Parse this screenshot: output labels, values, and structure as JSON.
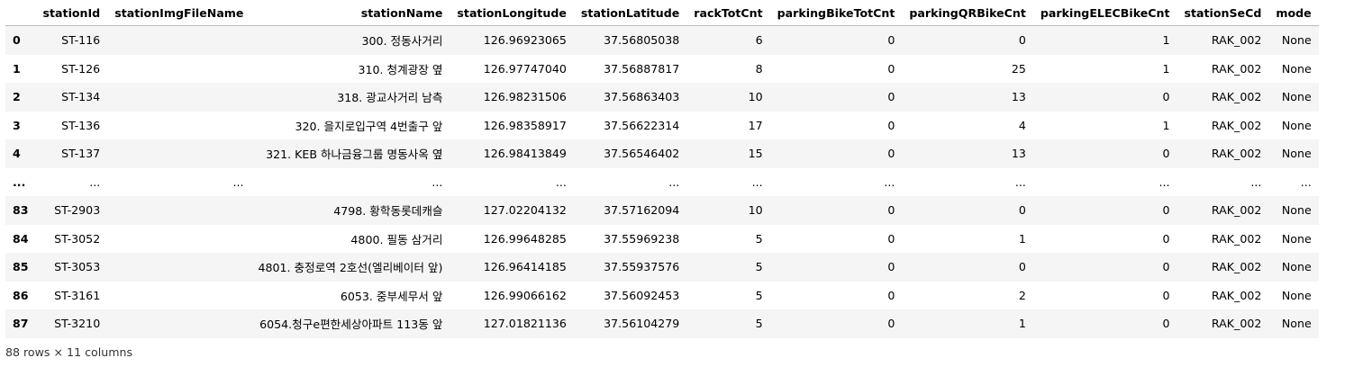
{
  "table": {
    "index_header": "",
    "columns": [
      "stationId",
      "stationImgFileName",
      "stationName",
      "stationLongitude",
      "stationLatitude",
      "rackTotCnt",
      "parkingBikeTotCnt",
      "parkingQRBikeCnt",
      "parkingELECBikeCnt",
      "stationSeCd",
      "mode"
    ],
    "rows": [
      {
        "index": "0",
        "cells": [
          "ST-116",
          "",
          "300. 정동사거리",
          "126.96923065",
          "37.56805038",
          "6",
          "0",
          "0",
          "1",
          "RAK_002",
          "None"
        ]
      },
      {
        "index": "1",
        "cells": [
          "ST-126",
          "",
          "310. 청계광장 옆",
          "126.97747040",
          "37.56887817",
          "8",
          "0",
          "25",
          "1",
          "RAK_002",
          "None"
        ]
      },
      {
        "index": "2",
        "cells": [
          "ST-134",
          "",
          "318. 광교사거리 남측",
          "126.98231506",
          "37.56863403",
          "10",
          "0",
          "13",
          "0",
          "RAK_002",
          "None"
        ]
      },
      {
        "index": "3",
        "cells": [
          "ST-136",
          "",
          "320. 을지로입구역 4번출구 앞",
          "126.98358917",
          "37.56622314",
          "17",
          "0",
          "4",
          "1",
          "RAK_002",
          "None"
        ]
      },
      {
        "index": "4",
        "cells": [
          "ST-137",
          "",
          "321. KEB 하나금융그룹 명동사옥 옆",
          "126.98413849",
          "37.56546402",
          "15",
          "0",
          "13",
          "0",
          "RAK_002",
          "None"
        ]
      },
      {
        "index": "...",
        "cells": [
          "...",
          "...",
          "...",
          "...",
          "...",
          "...",
          "...",
          "...",
          "...",
          "...",
          "..."
        ]
      },
      {
        "index": "83",
        "cells": [
          "ST-2903",
          "",
          "4798. 황학동롯데캐슬",
          "127.02204132",
          "37.57162094",
          "10",
          "0",
          "0",
          "0",
          "RAK_002",
          "None"
        ]
      },
      {
        "index": "84",
        "cells": [
          "ST-3052",
          "",
          "4800. 필동 삼거리",
          "126.99648285",
          "37.55969238",
          "5",
          "0",
          "1",
          "0",
          "RAK_002",
          "None"
        ]
      },
      {
        "index": "85",
        "cells": [
          "ST-3053",
          "",
          "4801. 충정로역 2호선(엘리베이터 앞)",
          "126.96414185",
          "37.55937576",
          "5",
          "0",
          "0",
          "0",
          "RAK_002",
          "None"
        ]
      },
      {
        "index": "86",
        "cells": [
          "ST-3161",
          "",
          "6053. 중부세무서 앞",
          "126.99066162",
          "37.56092453",
          "5",
          "0",
          "2",
          "0",
          "RAK_002",
          "None"
        ]
      },
      {
        "index": "87",
        "cells": [
          "ST-3210",
          "",
          "6054.청구e편한세상아파트 113동 앞",
          "127.01821136",
          "37.56104279",
          "5",
          "0",
          "1",
          "0",
          "RAK_002",
          "None"
        ]
      }
    ]
  },
  "footer": {
    "shape_text": "88 rows × 11 columns"
  }
}
